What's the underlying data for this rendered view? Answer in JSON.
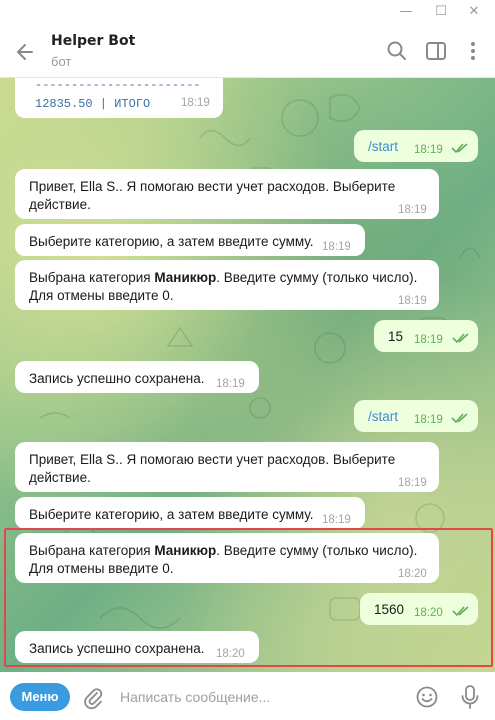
{
  "window": {
    "minimize": "—",
    "maximize": "☐",
    "close": "✕"
  },
  "header": {
    "title": "Helper Bot",
    "subtitle": "бот"
  },
  "messages": [
    {
      "side": "in",
      "line1": "-----------------------",
      "line2": "12835.50 | ИТОГО",
      "time": "18:19"
    },
    {
      "side": "out",
      "text": "/start",
      "time": "18:19"
    },
    {
      "side": "in",
      "line1": "Привет, Ella S.. Я помогаю вести учет расходов. Выберите",
      "line2": "действие.",
      "time": "18:19"
    },
    {
      "side": "in",
      "text": "Выберите категорию, а затем введите сумму.",
      "time": "18:19"
    },
    {
      "side": "in",
      "line1_a": "Выбрана категория ",
      "line1_b": "Маникюр",
      "line1_c": ". Введите сумму (только число).",
      "line2": "Для отмены введите 0.",
      "time": "18:19"
    },
    {
      "side": "out",
      "text": "15",
      "time": "18:19"
    },
    {
      "side": "in",
      "text": "Запись успешно сохранена.",
      "time": "18:19"
    },
    {
      "side": "out",
      "text": "/start",
      "time": "18:19"
    },
    {
      "side": "in",
      "line1": "Привет, Ella S.. Я помогаю вести учет расходов. Выберите",
      "line2": "действие.",
      "time": "18:19"
    },
    {
      "side": "in",
      "text": "Выберите категорию, а затем введите сумму.",
      "time": "18:19"
    },
    {
      "side": "in",
      "line1_a": "Выбрана категория ",
      "line1_b": "Маникюр",
      "line1_c": ". Введите сумму (только число).",
      "line2": "Для отмены введите 0.",
      "time": "18:20"
    },
    {
      "side": "out",
      "text": "1560",
      "time": "18:20"
    },
    {
      "side": "in",
      "text": "Запись успешно сохранена.",
      "time": "18:20"
    }
  ],
  "composer": {
    "menu_label": "Меню",
    "placeholder": "Написать сообщение..."
  },
  "colors": {
    "accent": "#3b9be0",
    "outgoing_bubble": "#eeffde",
    "highlight": "#e0484e"
  }
}
